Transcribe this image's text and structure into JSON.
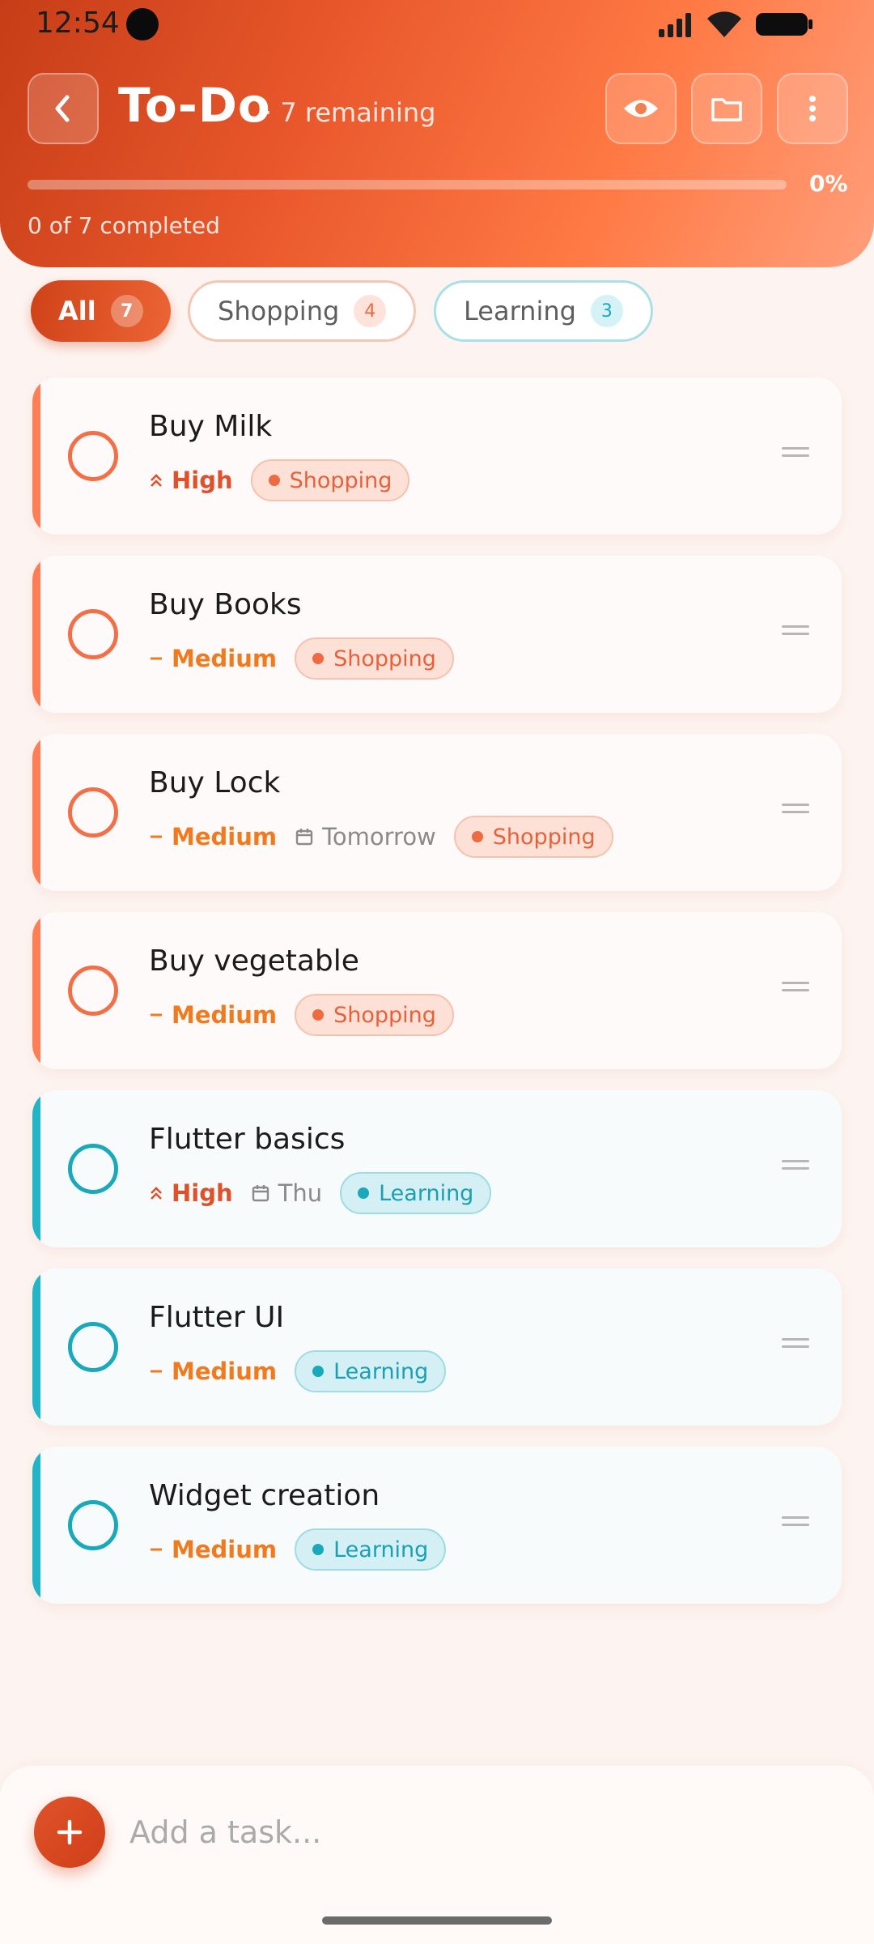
{
  "status_bar": {
    "time": "12:54"
  },
  "header": {
    "title": "To-Do",
    "subtitle": "· 7 remaining",
    "progress_percent": 0,
    "progress_label": "0%",
    "completed_text": "0 of 7 completed",
    "icons": {
      "back": "chevron-left-icon",
      "view": "eye-icon",
      "folder": "folder-icon",
      "menu": "more-vertical-icon"
    }
  },
  "filters": [
    {
      "label": "All",
      "count": "7",
      "selected": true
    },
    {
      "label": "Shopping",
      "count": "4",
      "selected": false
    },
    {
      "label": "Learning",
      "count": "3",
      "selected": false
    }
  ],
  "colors": {
    "accent": "#e8572b",
    "shopping": "#ff7e56",
    "learning": "#22b5c8",
    "high": "#e0502a",
    "medium": "#f17a1e"
  },
  "tasks": [
    {
      "title": "Buy Milk",
      "priority": "High",
      "due": "",
      "category": "Shopping"
    },
    {
      "title": "Buy Books",
      "priority": "Medium",
      "due": "",
      "category": "Shopping"
    },
    {
      "title": "Buy Lock",
      "priority": "Medium",
      "due": "Tomorrow",
      "category": "Shopping"
    },
    {
      "title": "Buy vegetable",
      "priority": "Medium",
      "due": "",
      "category": "Shopping"
    },
    {
      "title": "Flutter basics",
      "priority": "High",
      "due": "Thu",
      "category": "Learning"
    },
    {
      "title": "Flutter UI",
      "priority": "Medium",
      "due": "",
      "category": "Learning"
    },
    {
      "title": "Widget creation",
      "priority": "Medium",
      "due": "",
      "category": "Learning"
    }
  ],
  "add_task": {
    "placeholder": "Add a task..."
  }
}
